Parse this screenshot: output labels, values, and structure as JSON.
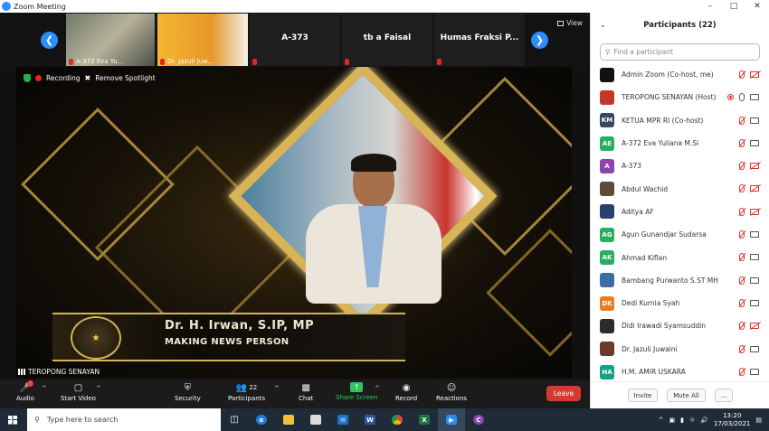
{
  "window": {
    "title": "Zoom Meeting",
    "controls": [
      "–",
      "□",
      "✕"
    ]
  },
  "strip": {
    "tiles": [
      {
        "name": "A-372 Eva Yu...",
        "type": "video"
      },
      {
        "name": "Dr. Jazuli Juw...",
        "type": "video"
      },
      {
        "name": "A-373",
        "type": "name"
      },
      {
        "name": "tb a Faisal",
        "type": "name"
      },
      {
        "name": "Humas Fraksi P...",
        "type": "name"
      }
    ],
    "view_label": "View"
  },
  "spotlight": {
    "recording_label": "Recording",
    "remove_spotlight_label": "Remove Spotlight",
    "speaker_name": "Dr. H. Irwan, S.IP, MP",
    "speaker_role": "MAKING NEWS PERSON",
    "active_speaker_label": "TEROPONG SENAYAN"
  },
  "toolbar": {
    "audio": "Audio",
    "video": "Start Video",
    "security": "Security",
    "participants": "Participants",
    "participants_count": "22",
    "chat": "Chat",
    "share": "Share Screen",
    "record": "Record",
    "reactions": "Reactions",
    "leave": "Leave"
  },
  "participants": {
    "header": "Participants (22)",
    "search_placeholder": "Find a participant",
    "items": [
      {
        "name": "Admin Zoom (Co-host, me)",
        "initials": "",
        "color": "#111111",
        "mic": "off",
        "cam": "off"
      },
      {
        "name": "TEROPONG SENAYAN (Host)",
        "initials": "",
        "color": "#c0392b",
        "mic": "on",
        "cam": "on",
        "recording": true
      },
      {
        "name": "KETUA MPR RI (Co-host)",
        "initials": "KM",
        "color": "#34495e",
        "mic": "off",
        "cam": "on"
      },
      {
        "name": "A-372 Eva Yuliana M.Si",
        "initials": "AE",
        "color": "#27ae60",
        "mic": "off",
        "cam": "on"
      },
      {
        "name": "A-373",
        "initials": "A",
        "color": "#8e44ad",
        "mic": "off",
        "cam": "off"
      },
      {
        "name": "Abdul Wachid",
        "initials": "",
        "color": "#5d4a3a",
        "mic": "off",
        "cam": "off"
      },
      {
        "name": "Aditya AF",
        "initials": "",
        "color": "#2c3e70",
        "mic": "off",
        "cam": "off"
      },
      {
        "name": "Agun Gunandjar Sudarsa",
        "initials": "AG",
        "color": "#27ae60",
        "mic": "off",
        "cam": "on"
      },
      {
        "name": "Ahmad Kiflan",
        "initials": "AK",
        "color": "#27ae60",
        "mic": "off",
        "cam": "on"
      },
      {
        "name": "Bambang Purwanto S.ST MH",
        "initials": "",
        "color": "#3a6ea5",
        "mic": "off",
        "cam": "on"
      },
      {
        "name": "Dedi Kurnia Syah",
        "initials": "DK",
        "color": "#e67e22",
        "mic": "off",
        "cam": "on"
      },
      {
        "name": "Didi Irawadi Syamsuddin",
        "initials": "",
        "color": "#2b2b2b",
        "mic": "off",
        "cam": "off"
      },
      {
        "name": "Dr. Jazuli Juwaini",
        "initials": "",
        "color": "#6b3a2a",
        "mic": "off",
        "cam": "on"
      },
      {
        "name": "H.M. AMIR USKARA",
        "initials": "HA",
        "color": "#16a085",
        "mic": "off",
        "cam": "on"
      }
    ],
    "invite_label": "Invite",
    "mute_all_label": "Mute All",
    "more_label": "..."
  },
  "taskbar": {
    "search_placeholder": "Type here to search",
    "time": "13:20",
    "date": "17/03/2021"
  }
}
